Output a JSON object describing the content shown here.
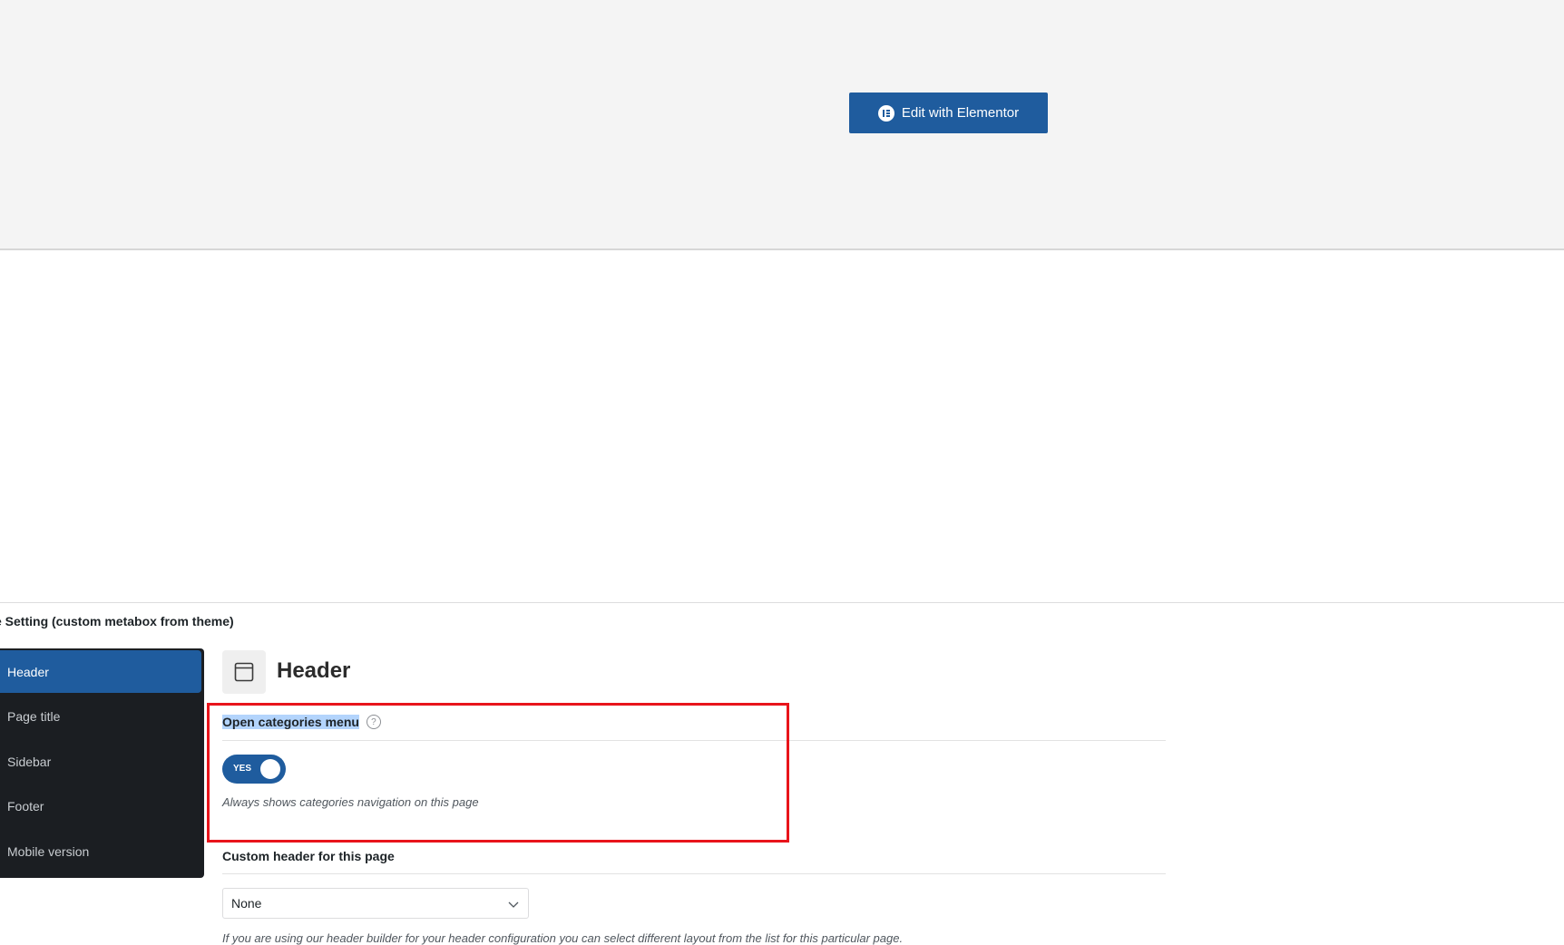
{
  "top": {
    "edit_button_label": "Edit with Elementor",
    "edit_button_icon": "elementor-icon"
  },
  "metabox": {
    "title": "e Setting (custom metabox from theme)",
    "sidebar": {
      "items": [
        {
          "label": "Header",
          "active": true
        },
        {
          "label": "Page title",
          "active": false
        },
        {
          "label": "Sidebar",
          "active": false
        },
        {
          "label": "Footer",
          "active": false
        },
        {
          "label": "Mobile version",
          "active": false
        }
      ]
    },
    "panel": {
      "icon": "window-icon",
      "title": "Header",
      "fields": [
        {
          "label": "Open categories menu",
          "help_icon": "?",
          "toggle_label": "YES",
          "toggle_value": true,
          "description": "Always shows categories navigation on this page"
        },
        {
          "label": "Custom header for this page",
          "select_value": "None",
          "description": "If you are using our header builder for your header configuration you can select different layout from the list for this particular page."
        }
      ]
    }
  },
  "colors": {
    "accent": "#1f5c9e",
    "sidebar_bg": "#1b1e22",
    "annotation_red": "#e8141b",
    "text_highlight": "#b3d4fc"
  }
}
